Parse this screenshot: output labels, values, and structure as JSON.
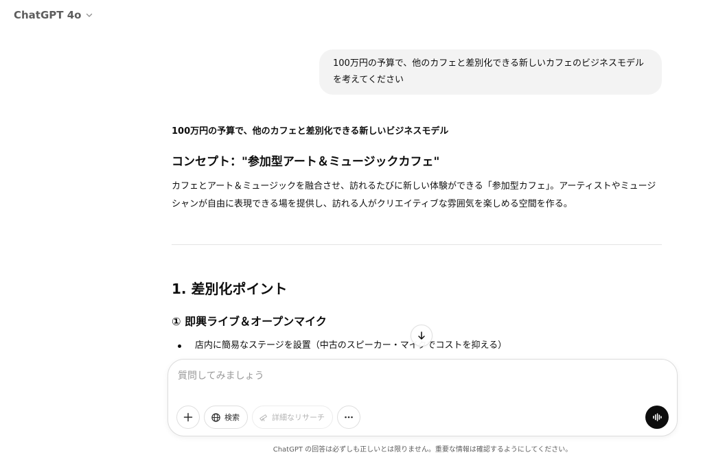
{
  "header": {
    "model_name": "ChatGPT 4o"
  },
  "conversation": {
    "user_message": "100万円の予算で、他のカフェと差別化できる新しいカフェのビジネスモデルを考えてください",
    "response": {
      "subtitle": "100万円の予算で、他のカフェと差別化できる新しいビジネスモデル",
      "concept_heading": "コンセプト：\"参加型アート＆ミュージックカフェ\"",
      "concept_text": "カフェとアート＆ミュージックを融合させ、訪れるたびに新しい体験ができる「参加型カフェ」。アーティストやミュージシャンが自由に表現できる場を提供し、訪れる人がクリエイティブな雰囲気を楽しめる空間を作る。",
      "section_heading": "1. 差別化ポイント",
      "subsection_heading": "① 即興ライブ＆オープンマイク",
      "bullet_1": "店内に簡易なステージを設置（中古のスピーカー・マイクでコストを抑える）"
    }
  },
  "composer": {
    "placeholder": "質問してみましょう",
    "value": "",
    "search_label": "検索",
    "deep_research_label": "詳細なリサーチ"
  },
  "footer": {
    "disclaimer": "ChatGPT の回答は必ずしも正しいとは限りません。重要な情報は確認するようにしてください。"
  },
  "icons": {
    "model_dropdown": "chevron-down-icon",
    "scroll_down": "arrow-down-icon",
    "attach": "plus-icon",
    "search": "globe-icon",
    "deep_research": "telescope-icon",
    "more": "more-horizontal-icon",
    "voice": "voice-waveform-icon"
  },
  "colors": {
    "bubble_bg": "#f3f3f3",
    "text": "#0d0d0d",
    "muted": "#5d5d5d",
    "voice_button": "#0d0d0d"
  }
}
